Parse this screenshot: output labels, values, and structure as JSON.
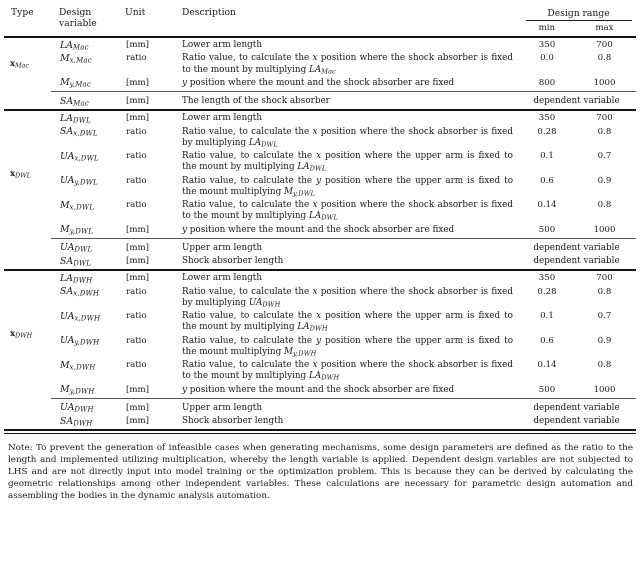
{
  "table": {
    "headers": {
      "type": "Type",
      "design_variable_line1": "Design",
      "design_variable_line2": "variable",
      "unit": "Unit",
      "description": "Description",
      "design_range": "Design range",
      "min": "min",
      "max": "max"
    },
    "dependent_label": "dependent variable",
    "groups": [
      {
        "type_base": "x",
        "type_sub": "Mac",
        "rows": [
          {
            "var_base": "LA",
            "var_sub": "Mac",
            "unit": "[mm]",
            "description": "Lower arm length",
            "min": "350",
            "max": "700"
          },
          {
            "var_base": "M",
            "var_sub": "x,Mac",
            "unit": "ratio",
            "description": "Ratio value, to calculate the x position where the shock absorber is fixed to the mount by multiplying LA_Mac",
            "min": "0.0",
            "max": "0.8"
          },
          {
            "var_base": "M",
            "var_sub": "y,Mac",
            "unit": "[mm]",
            "description": "y position where the mount and the shock absorber are fixed",
            "min": "800",
            "max": "1000"
          }
        ],
        "dependent_rows": [
          {
            "var_base": "SA",
            "var_sub": "Mac",
            "unit": "[mm]",
            "description": "The length of the shock absorber"
          }
        ]
      },
      {
        "type_base": "x",
        "type_sub": "DWL",
        "rows": [
          {
            "var_base": "LA",
            "var_sub": "DWL",
            "unit": "[mm]",
            "description": "Lower arm length",
            "min": "350",
            "max": "700"
          },
          {
            "var_base": "SA",
            "var_sub": "x,DWL",
            "unit": "ratio",
            "description": "Ratio value, to calculate the x position where the shock absorber is fixed by multiplying LA_DWL",
            "min": "0.28",
            "max": "0.8"
          },
          {
            "var_base": "UA",
            "var_sub": "x,DWL",
            "unit": "ratio",
            "description": "Ratio value, to calculate the x position where the upper arm is fixed to the mount by multiplying LA_DWL",
            "min": "0.1",
            "max": "0.7"
          },
          {
            "var_base": "UA",
            "var_sub": "y,DWL",
            "unit": "ratio",
            "description": "Ratio value, to calculate the y position where the upper arm is fixed to the mount multiplying M_y,DWL",
            "min": "0.6",
            "max": "0.9"
          },
          {
            "var_base": "M",
            "var_sub": "x,DWL",
            "unit": "ratio",
            "description": "Ratio value, to calculate the x position where the shock absorber is fixed to the mount by multiplying LA_DWL",
            "min": "0.14",
            "max": "0.8"
          },
          {
            "var_base": "M",
            "var_sub": "y,DWL",
            "unit": "[mm]",
            "description": "y position where the mount and the shock absorber are fixed",
            "min": "500",
            "max": "1000"
          }
        ],
        "dependent_rows": [
          {
            "var_base": "UA",
            "var_sub": "DWL",
            "unit": "[mm]",
            "description": "Upper arm length"
          },
          {
            "var_base": "SA",
            "var_sub": "DWL",
            "unit": "[mm]",
            "description": "Shock absorber length"
          }
        ]
      },
      {
        "type_base": "x",
        "type_sub": "DWH",
        "rows": [
          {
            "var_base": "LA",
            "var_sub": "DWH",
            "unit": "[mm]",
            "description": "Lower arm length",
            "min": "350",
            "max": "700"
          },
          {
            "var_base": "SA",
            "var_sub": "x,DWH",
            "unit": "ratio",
            "description": "Ratio value, to calculate the x position where the shock absorber is fixed by multiplying UA_DWH",
            "min": "0.28",
            "max": "0.8"
          },
          {
            "var_base": "UA",
            "var_sub": "x,DWH",
            "unit": "ratio",
            "description": "Ratio value, to calculate the x position where the upper arm is fixed to the mount by multiplying LA_DWH",
            "min": "0.1",
            "max": "0.7"
          },
          {
            "var_base": "UA",
            "var_sub": "y,DWH",
            "unit": "ratio",
            "description": "Ratio value, to calculate the y position where the upper arm is fixed to the mount multiplying M_y,DWH",
            "min": "0.6",
            "max": "0.9"
          },
          {
            "var_base": "M",
            "var_sub": "x,DWH",
            "unit": "ratio",
            "description": "Ratio value, to calculate the x position where the shock absorber is fixed to the mount by multiplying LA_DWH",
            "min": "0.14",
            "max": "0.8"
          },
          {
            "var_base": "M",
            "var_sub": "y,DWH",
            "unit": "[mm]",
            "description": "y position where the mount and the shock absorber are fixed",
            "min": "500",
            "max": "1000"
          }
        ],
        "dependent_rows": [
          {
            "var_base": "UA",
            "var_sub": "DWH",
            "unit": "[mm]",
            "description": "Upper arm length"
          },
          {
            "var_base": "SA",
            "var_sub": "DWH",
            "unit": "[mm]",
            "description": "Shock absorber length"
          }
        ]
      }
    ]
  },
  "note": {
    "text": "Note: To prevent the generation of infeasible cases when generating mechanisms, some design parameters are defined as the ratio to the length and implemented utilizing multiplication, whereby the length variable is applied. Dependent design variables are not subjected to LHS and are not directly input into model training or the optimization problem. This is because they can be derived by calculating the geometric relationships among other independent variables. These calculations are necessary for parametric design automation and assembling the bodies in the dynamic analysis automation."
  }
}
